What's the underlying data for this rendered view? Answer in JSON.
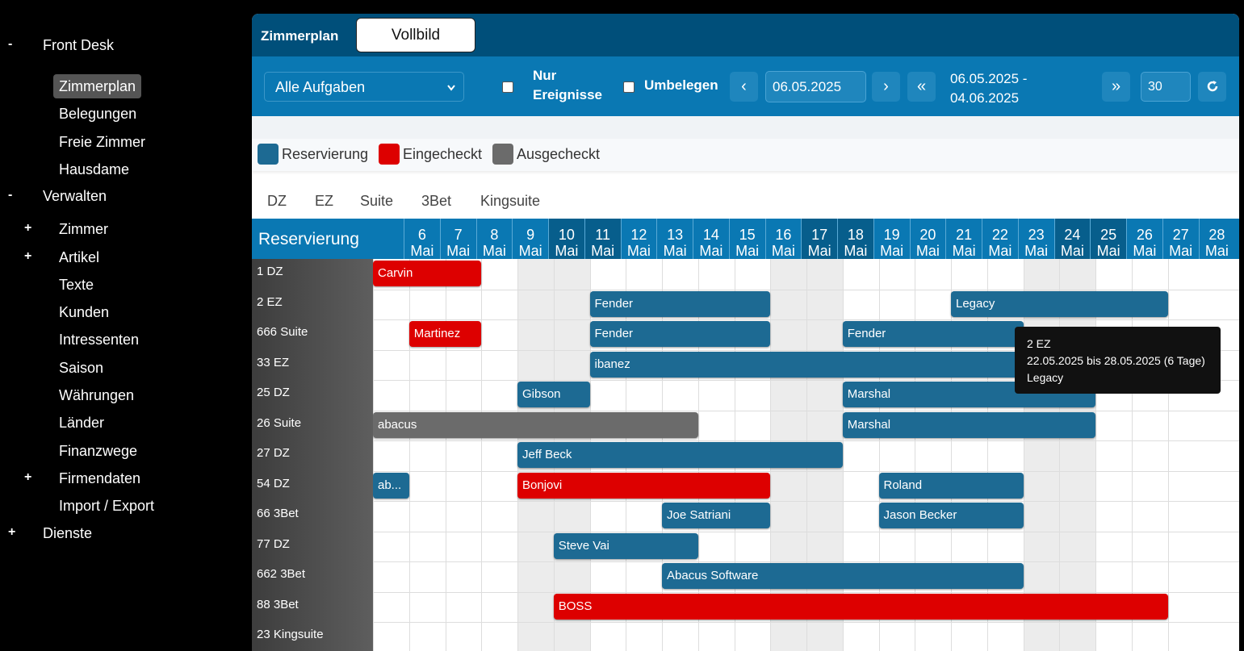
{
  "sidebar": {
    "sections": [
      {
        "sign": "-",
        "label": "Front Desk",
        "items": [
          {
            "sign": "",
            "label": "Zimmerplan",
            "active": true
          },
          {
            "sign": "",
            "label": "Belegungen"
          },
          {
            "sign": "",
            "label": "Freie Zimmer"
          },
          {
            "sign": "",
            "label": "Hausdame"
          }
        ]
      },
      {
        "sign": "-",
        "label": "Verwalten",
        "items": [
          {
            "sign": "+",
            "label": "Zimmer"
          },
          {
            "sign": "+",
            "label": "Artikel"
          },
          {
            "sign": "",
            "label": "Texte"
          },
          {
            "sign": "",
            "label": "Kunden"
          },
          {
            "sign": "",
            "label": "Intressenten"
          },
          {
            "sign": "",
            "label": "Saison"
          },
          {
            "sign": "",
            "label": "Währungen"
          },
          {
            "sign": "",
            "label": "Länder"
          },
          {
            "sign": "",
            "label": "Finanzwege"
          },
          {
            "sign": "+",
            "label": "Firmendaten"
          },
          {
            "sign": "",
            "label": "Import / Export"
          }
        ]
      },
      {
        "sign": "+",
        "label": "Dienste",
        "items": []
      }
    ]
  },
  "header": {
    "title": "Zimmerplan",
    "fullscreen_label": "Vollbild"
  },
  "toolbar": {
    "task_select": "Alle Aufgaben",
    "only_events_label": "Nur Ereignisse",
    "rebook_label": "Umbelegen",
    "date_value": "06.05.2025",
    "range_line1": "06.05.2025 -",
    "range_line2": "04.06.2025",
    "days_value": "30",
    "icons": {
      "prev": "‹",
      "next": "›",
      "prev_fast": "«",
      "next_fast": "»",
      "refresh": "refresh-icon"
    }
  },
  "legend": [
    {
      "label": "Reservierung",
      "color": "#1d6a93"
    },
    {
      "label": "Eingecheckt",
      "color": "#dd0000"
    },
    {
      "label": "Ausgecheckt",
      "color": "#6b6b6b"
    }
  ],
  "filters": [
    "DZ",
    "EZ",
    "Suite",
    "3Bet",
    "Kingsuite"
  ],
  "grid": {
    "title": "Reservierung",
    "month": "Mai",
    "days": [
      {
        "d": "6",
        "weekend": false
      },
      {
        "d": "7",
        "weekend": false
      },
      {
        "d": "8",
        "weekend": false
      },
      {
        "d": "9",
        "weekend": false
      },
      {
        "d": "10",
        "weekend": true
      },
      {
        "d": "11",
        "weekend": true
      },
      {
        "d": "12",
        "weekend": false
      },
      {
        "d": "13",
        "weekend": false
      },
      {
        "d": "14",
        "weekend": false
      },
      {
        "d": "15",
        "weekend": false
      },
      {
        "d": "16",
        "weekend": false
      },
      {
        "d": "17",
        "weekend": true
      },
      {
        "d": "18",
        "weekend": true
      },
      {
        "d": "19",
        "weekend": false
      },
      {
        "d": "20",
        "weekend": false
      },
      {
        "d": "21",
        "weekend": false
      },
      {
        "d": "22",
        "weekend": false
      },
      {
        "d": "23",
        "weekend": false
      },
      {
        "d": "24",
        "weekend": true
      },
      {
        "d": "25",
        "weekend": true
      },
      {
        "d": "26",
        "weekend": false
      },
      {
        "d": "27",
        "weekend": false
      },
      {
        "d": "28",
        "weekend": false
      }
    ],
    "rooms": [
      "1 DZ",
      "2 EZ",
      "666 Suite",
      "33 EZ",
      "25 DZ",
      "26 Suite",
      "27 DZ",
      "54 DZ",
      "66 3Bet",
      "77 DZ",
      "662 3Bet",
      "88 3Bet",
      "23 Kingsuite"
    ],
    "bookings": [
      {
        "room": 0,
        "start": 6,
        "end": 9,
        "label": "Carvin",
        "status": "Eingecheckt"
      },
      {
        "room": 1,
        "start": 12,
        "end": 17,
        "label": "Fender",
        "status": "Reservierung"
      },
      {
        "room": 1,
        "start": 22,
        "end": 28,
        "label": "Legacy",
        "status": "Reservierung"
      },
      {
        "room": 2,
        "start": 7,
        "end": 9,
        "label": "Martinez",
        "status": "Eingecheckt"
      },
      {
        "room": 2,
        "start": 12,
        "end": 17,
        "label": "Fender",
        "status": "Reservierung"
      },
      {
        "room": 2,
        "start": 19,
        "end": 24,
        "label": "Fender",
        "status": "Reservierung"
      },
      {
        "room": 3,
        "start": 12,
        "end": 24,
        "label": "ibanez",
        "status": "Reservierung"
      },
      {
        "room": 4,
        "start": 10,
        "end": 12,
        "label": "Gibson",
        "status": "Reservierung"
      },
      {
        "room": 4,
        "start": 19,
        "end": 26,
        "label": "Marshal",
        "status": "Reservierung"
      },
      {
        "room": 5,
        "start": 6,
        "end": 15,
        "label": "abacus",
        "status": "Ausgecheckt"
      },
      {
        "room": 5,
        "start": 19,
        "end": 26,
        "label": "Marshal",
        "status": "Reservierung"
      },
      {
        "room": 6,
        "start": 10,
        "end": 19,
        "label": "Jeff Beck",
        "status": "Reservierung"
      },
      {
        "room": 7,
        "start": 6,
        "end": 7,
        "label": "ab...",
        "status": "Reservierung"
      },
      {
        "room": 7,
        "start": 10,
        "end": 17,
        "label": "Bonjovi",
        "status": "Eingecheckt"
      },
      {
        "room": 7,
        "start": 20,
        "end": 24,
        "label": "Roland",
        "status": "Reservierung"
      },
      {
        "room": 8,
        "start": 14,
        "end": 17,
        "label": "Joe Satriani",
        "status": "Reservierung"
      },
      {
        "room": 8,
        "start": 20,
        "end": 24,
        "label": "Jason Becker",
        "status": "Reservierung"
      },
      {
        "room": 9,
        "start": 11,
        "end": 15,
        "label": "Steve Vai",
        "status": "Reservierung"
      },
      {
        "room": 10,
        "start": 14,
        "end": 24,
        "label": "Abacus Software",
        "status": "Reservierung"
      },
      {
        "room": 11,
        "start": 11,
        "end": 28,
        "label": "BOSS",
        "status": "Eingecheckt"
      }
    ]
  },
  "tooltip": {
    "line1": "2 EZ",
    "line2": "22.05.2025 bis 28.05.2025 (6 Tage)",
    "line3": "Legacy"
  }
}
